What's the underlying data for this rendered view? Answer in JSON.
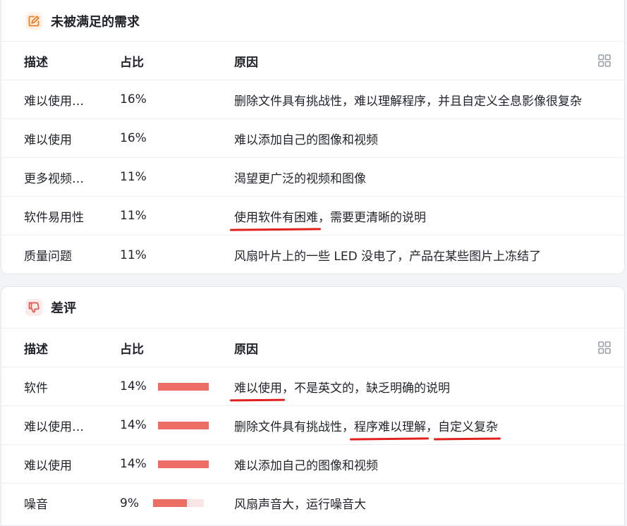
{
  "unmet": {
    "title": "未被满足的需求",
    "icon": "edit-icon",
    "columns": {
      "desc": "描述",
      "pct": "占比",
      "reason": "原因"
    },
    "rows": [
      {
        "desc": "难以使用…",
        "pct": "16%",
        "reason": [
          "删除文件具有挑战性，难以理解程序，并且自定义全息影像很复杂"
        ]
      },
      {
        "desc": "难以使用",
        "pct": "16%",
        "reason": [
          "难以添加自己的图像和视频"
        ]
      },
      {
        "desc": "更多视频…",
        "pct": "11%",
        "reason": [
          "渴望更广泛的视频和图像"
        ]
      },
      {
        "desc": "软件易用性",
        "pct": "11%",
        "reason": [
          "使用软件有困难",
          "，需要更清晰的说明"
        ]
      },
      {
        "desc": "质量问题",
        "pct": "11%",
        "reason": [
          "风扇叶片上的一些 LED 没电了，产品在某些图片上冻结了"
        ]
      }
    ]
  },
  "negative": {
    "title": "差评",
    "icon": "thumbs-down-icon",
    "columns": {
      "desc": "描述",
      "pct": "占比",
      "reason": "原因"
    },
    "rows": [
      {
        "desc": "软件",
        "pct": "14%",
        "fill": 1.0,
        "reason": [
          "难以使用",
          "，不是英文的，缺乏明确的说明"
        ]
      },
      {
        "desc": "难以使用…",
        "pct": "14%",
        "fill": 1.0,
        "reason": [
          "删除文件具有挑战性，",
          "程序难以理解",
          "，",
          "自定义复杂"
        ]
      },
      {
        "desc": "难以使用",
        "pct": "14%",
        "fill": 1.0,
        "reason": [
          "难以添加自己的图像和视频"
        ]
      },
      {
        "desc": "噪音",
        "pct": "9%",
        "fill": 0.66,
        "reason": [
          "风扇声音大，运行噪音大"
        ]
      }
    ]
  },
  "colors": {
    "bar": "#ec6e65",
    "bar_track": "#fbe4e4",
    "annotation": "#e0211d",
    "edit_icon": "#f07a1f",
    "thumb_icon": "#e5534b"
  }
}
